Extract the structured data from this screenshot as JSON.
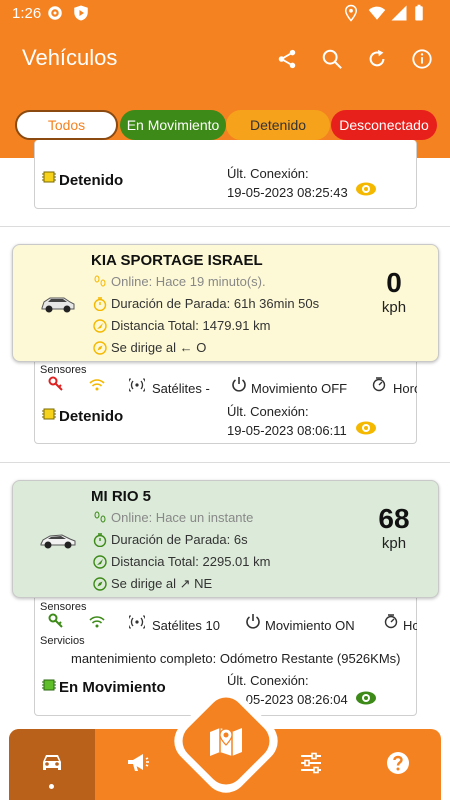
{
  "status_bar": {
    "time": "1:26"
  },
  "app_bar": {
    "title": "Vehículos"
  },
  "filters": [
    "Todos",
    "En Movimiento",
    "Detenido",
    "Desconectado"
  ],
  "colors": {
    "primary": "#f58220",
    "moving": "#3d8a19",
    "stopped": "#f7a21b",
    "disconnected": "#e8201c"
  },
  "top_card": {
    "status": "Detenido",
    "conn_label": "Últ. Conexión:",
    "conn_time": "19-05-2023 08:25:43"
  },
  "vehicles": [
    {
      "name": "KIA SPORTAGE ISRAEL",
      "online": "Online: Hace 19 minuto(s).",
      "stop": "Duración de Parada: 61h 36min 50s",
      "distance": "Distancia Total: 1479.91 km",
      "heading": "Se dirige al ← O",
      "speed": "0",
      "speed_unit": "kph",
      "sensors_label": "Sensores",
      "satellites": "Satélites -",
      "movement": "Movimiento OFF",
      "extra": "Horó",
      "status": "Detenido",
      "conn_label": "Últ. Conexión:",
      "conn_time": "19-05-2023 08:06:11"
    },
    {
      "name": "MI RIO 5",
      "online": "Online: Hace un instante",
      "stop": "Duración de Parada: 6s",
      "distance": "Distancia Total: 2295.01 km",
      "heading": "Se dirige al ↗ NE",
      "speed": "68",
      "speed_unit": "kph",
      "sensors_label": "Sensores",
      "services_label": "Servicios",
      "satellites": "Satélites 10",
      "movement": "Movimiento ON",
      "extra": "Ho",
      "maintenance": "mantenimiento completo: Odómetro Restante (9526KMs)",
      "status": "En Movimiento",
      "conn_label": "Últ. Conexión:",
      "conn_time": "19-05-2023 08:26:04"
    }
  ]
}
